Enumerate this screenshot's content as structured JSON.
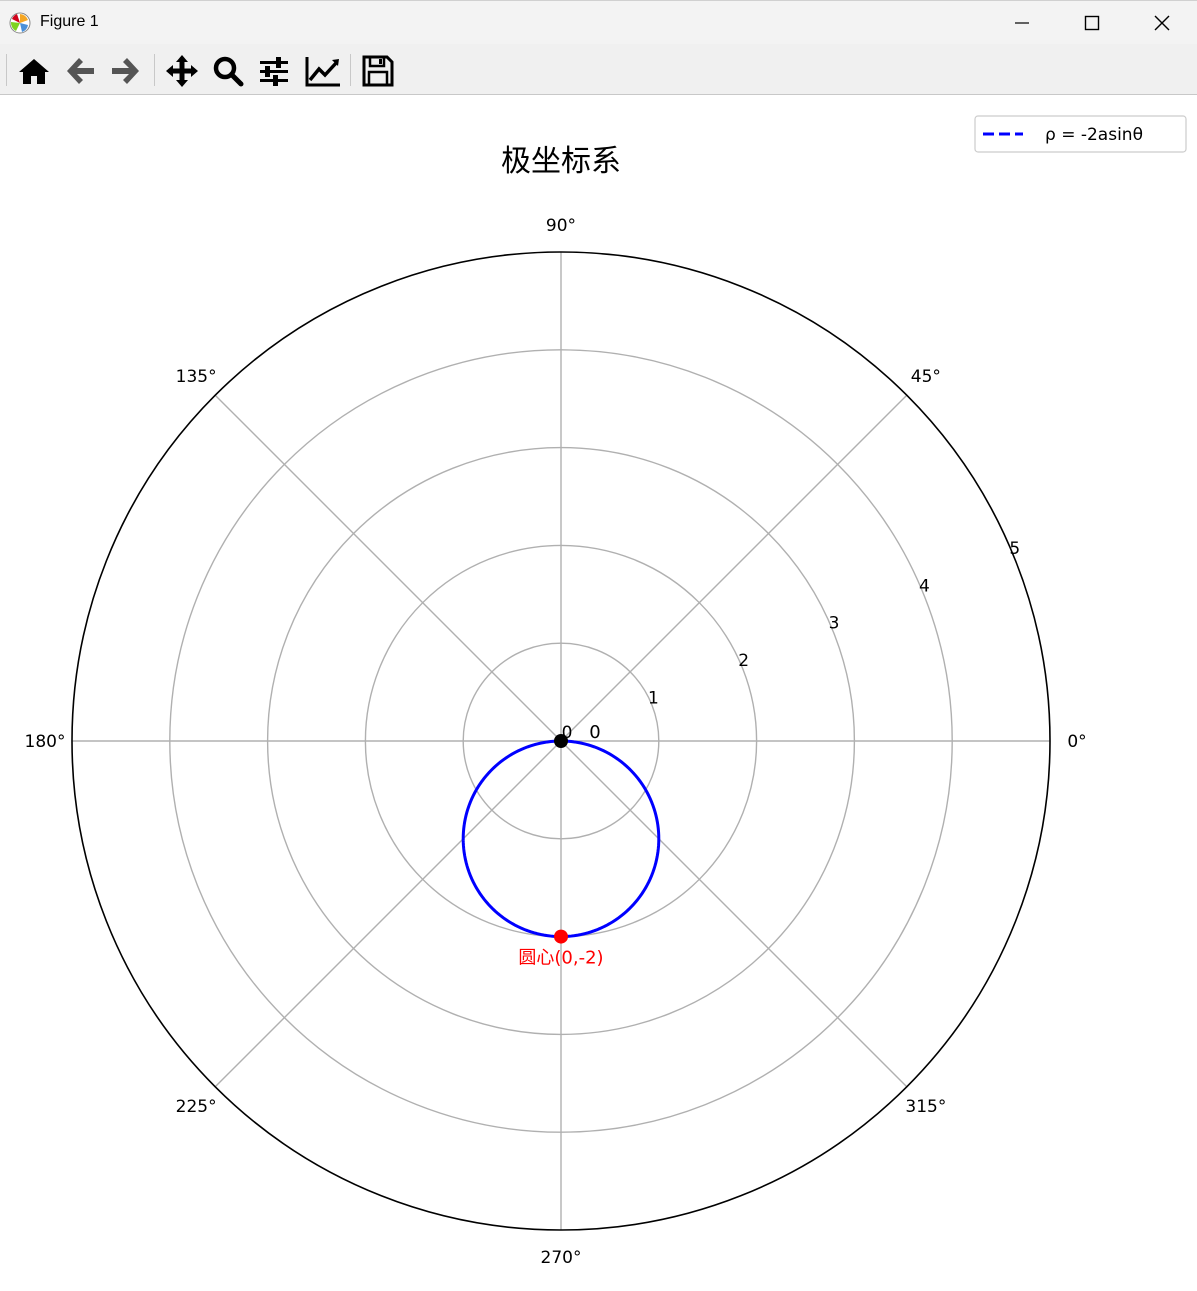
{
  "window": {
    "title": "Figure 1",
    "icon_name": "matplotlib-icon",
    "controls": [
      "minimize-icon",
      "maximize-icon",
      "close-icon"
    ]
  },
  "toolbar": {
    "buttons": [
      {
        "name": "home",
        "icon": "home-icon"
      },
      {
        "name": "back",
        "icon": "arrow-left-icon"
      },
      {
        "name": "forward",
        "icon": "arrow-right-icon"
      },
      {
        "name": "pan",
        "icon": "move-icon"
      },
      {
        "name": "zoom",
        "icon": "zoom-icon"
      },
      {
        "name": "subplots",
        "icon": "sliders-icon"
      },
      {
        "name": "axes",
        "icon": "line-chart-icon"
      },
      {
        "name": "save",
        "icon": "save-icon"
      }
    ]
  },
  "chart_data": {
    "type": "polar-line",
    "title": "极坐标系",
    "theta_ticks": [
      {
        "deg": 0,
        "label": "0°"
      },
      {
        "deg": 45,
        "label": "45°"
      },
      {
        "deg": 90,
        "label": "90°"
      },
      {
        "deg": 135,
        "label": "135°"
      },
      {
        "deg": 180,
        "label": "180°"
      },
      {
        "deg": 225,
        "label": "225°"
      },
      {
        "deg": 270,
        "label": "270°"
      },
      {
        "deg": 315,
        "label": "315°"
      }
    ],
    "r_ticks": [
      {
        "value": 0,
        "label": "0"
      },
      {
        "value": 1,
        "label": "1"
      },
      {
        "value": 2,
        "label": "2"
      },
      {
        "value": 3,
        "label": "3"
      },
      {
        "value": 4,
        "label": "4"
      },
      {
        "value": 5,
        "label": "5"
      }
    ],
    "r_label_angle_deg": 22.5,
    "rlim": [
      0,
      5
    ],
    "grid": true,
    "series": [
      {
        "name": "ρ = -2asinθ",
        "formula_a": 2,
        "color": "#0000ff",
        "style": "dashed",
        "theta_range_deg": [
          0,
          360
        ]
      }
    ],
    "points": [
      {
        "label": "0",
        "r": 0,
        "theta_deg": 0,
        "color": "#000000"
      },
      {
        "label": "圆心(0,-2)",
        "r": 2,
        "theta_deg": 270,
        "color": "#ff0000"
      }
    ],
    "legend": {
      "position": "top-right",
      "entry": "ρ = -2asinθ"
    }
  }
}
